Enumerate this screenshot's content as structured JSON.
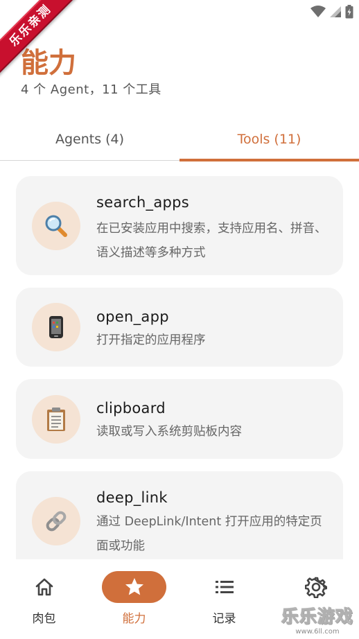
{
  "ribbon": {
    "text": "乐乐亲测"
  },
  "header": {
    "title": "能力",
    "subtitle": "4 个 Agent，11 个工具"
  },
  "tabs": [
    {
      "label": "Agents (4)",
      "active": false
    },
    {
      "label": "Tools (11)",
      "active": true
    }
  ],
  "tools": [
    {
      "name": "search_apps",
      "description": "在已安装应用中搜索，支持应用名、拼音、语义描述等多种方式",
      "icon": "magnifier-icon"
    },
    {
      "name": "open_app",
      "description": "打开指定的应用程序",
      "icon": "phone-icon"
    },
    {
      "name": "clipboard",
      "description": "读取或写入系统剪贴板内容",
      "icon": "clipboard-icon"
    },
    {
      "name": "deep_link",
      "description": "通过 DeepLink/Intent 打开应用的特定页面或功能",
      "icon": "link-icon"
    }
  ],
  "bottom_nav": [
    {
      "label": "肉包",
      "icon": "home-icon",
      "active": false
    },
    {
      "label": "能力",
      "icon": "star-icon",
      "active": true
    },
    {
      "label": "记录",
      "icon": "list-icon",
      "active": false
    },
    {
      "label": "设置",
      "icon": "gear-icon",
      "active": false
    }
  ],
  "watermark": {
    "main": "乐乐游戏",
    "url": "www.6ll.com"
  },
  "colors": {
    "accent": "#d06f3b",
    "card": "#f4f4f4",
    "icon_bg": "#f5e3d4"
  }
}
